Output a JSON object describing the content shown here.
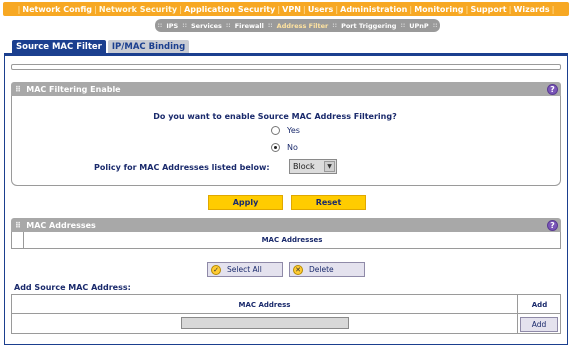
{
  "top_nav": [
    "Network Config",
    "Network Security",
    "Application Security",
    "VPN",
    "Users",
    "Administration",
    "Monitoring",
    "Support",
    "Wizards"
  ],
  "sub_nav": [
    "IPS",
    "Services",
    "Firewall",
    "Address Filter",
    "Port Triggering",
    "UPnP"
  ],
  "tabs": [
    "Source MAC Filter",
    "IP/MAC Binding"
  ],
  "mac_filtering": {
    "title": "MAC Filtering Enable",
    "question": "Do you want to enable Source MAC Address Filtering?",
    "yes_label": "Yes",
    "no_label": "No",
    "selected": "No",
    "policy_label": "Policy for MAC Addresses listed below:",
    "policy_value": "Block"
  },
  "buttons": {
    "apply": "Apply",
    "reset": "Reset",
    "select_all": "Select All",
    "delete": "Delete",
    "add": "Add"
  },
  "mac_addresses": {
    "title": "MAC Addresses",
    "column_header": "MAC Addresses"
  },
  "add_section": {
    "title": "Add Source MAC Address:",
    "col_mac": "MAC Address",
    "col_add": "Add"
  },
  "help_glyph": "?",
  "colors": {
    "nav_orange": "#f7a823",
    "tab_blue": "#1b3f8f",
    "button_yellow": "#ffcc00",
    "panel_grey": "#a8a8a8",
    "help_purple": "#7a55b8"
  }
}
